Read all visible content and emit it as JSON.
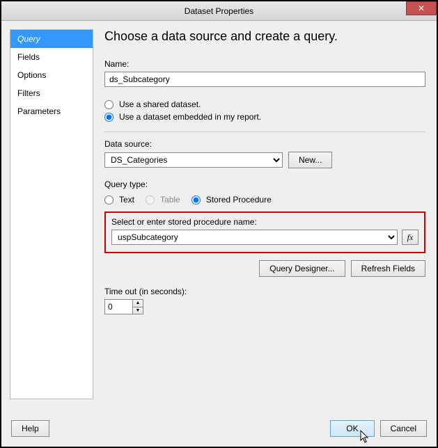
{
  "title": "Dataset Properties",
  "sidebar": {
    "items": [
      {
        "label": "Query",
        "selected": true
      },
      {
        "label": "Fields"
      },
      {
        "label": "Options"
      },
      {
        "label": "Filters"
      },
      {
        "label": "Parameters"
      }
    ]
  },
  "main": {
    "heading": "Choose a data source and create a query.",
    "name_label": "Name:",
    "name_value": "ds_Subcategory",
    "shared_label": "Use a shared dataset.",
    "embedded_label": "Use a dataset embedded in my report.",
    "datasource_label": "Data source:",
    "datasource_value": "DS_Categories",
    "new_label": "New...",
    "querytype_label": "Query type:",
    "qt_text": "Text",
    "qt_table": "Table",
    "qt_sp": "Stored Procedure",
    "sp_label": "Select or enter stored procedure name:",
    "sp_value": "uspSubcategory",
    "fx_label": "fx",
    "qd_label": "Query Designer...",
    "refresh_label": "Refresh Fields",
    "timeout_label": "Time out (in seconds):",
    "timeout_value": "0"
  },
  "footer": {
    "help": "Help",
    "ok": "OK",
    "cancel": "Cancel"
  },
  "close_glyph": "✕"
}
